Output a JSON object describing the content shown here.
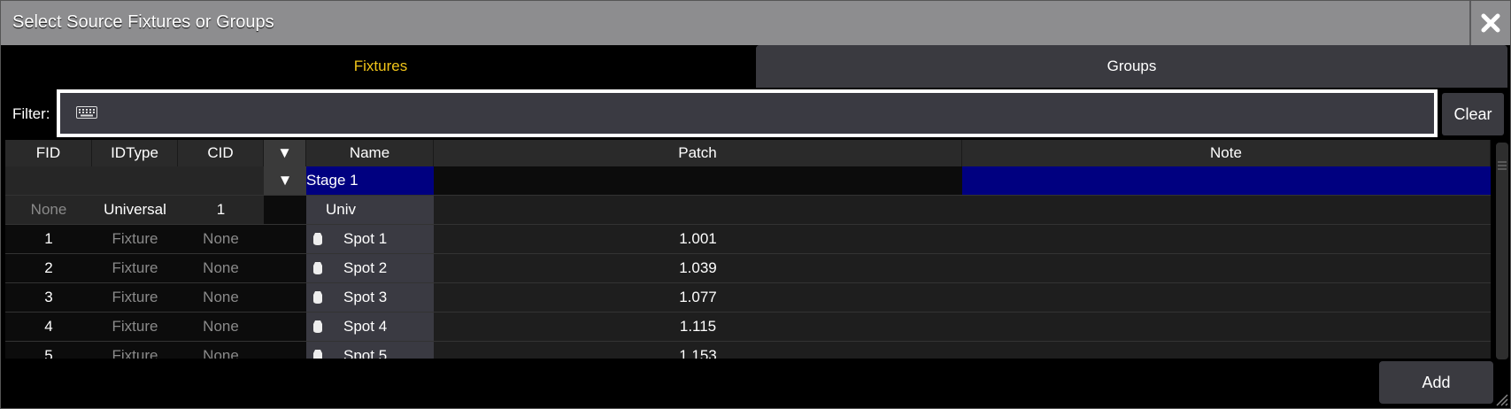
{
  "window": {
    "title": "Select Source Fixtures or Groups"
  },
  "tabs": [
    {
      "label": "Fixtures",
      "active": true
    },
    {
      "label": "Groups",
      "active": false
    }
  ],
  "filter": {
    "label": "Filter:",
    "value": "",
    "clear_label": "Clear"
  },
  "columns": [
    "FID",
    "IDType",
    "CID",
    "▼",
    "Name",
    "Patch",
    "Note"
  ],
  "stage": {
    "toggle": "▼",
    "name": "Stage 1"
  },
  "universal_row": {
    "fid": "None",
    "idtype": "Universal",
    "cid": "1",
    "name": "Univ"
  },
  "fixtures": [
    {
      "fid": "1",
      "idtype": "Fixture",
      "cid": "None",
      "name": "Spot 1",
      "patch": "1.001"
    },
    {
      "fid": "2",
      "idtype": "Fixture",
      "cid": "None",
      "name": "Spot 2",
      "patch": "1.039"
    },
    {
      "fid": "3",
      "idtype": "Fixture",
      "cid": "None",
      "name": "Spot 3",
      "patch": "1.077"
    },
    {
      "fid": "4",
      "idtype": "Fixture",
      "cid": "None",
      "name": "Spot 4",
      "patch": "1.115"
    },
    {
      "fid": "5",
      "idtype": "Fixture",
      "cid": "None",
      "name": "Spot 5",
      "patch": "1.153"
    }
  ],
  "footer": {
    "add_label": "Add"
  },
  "icons": {
    "close": "close-icon",
    "keyboard": "keyboard-icon",
    "fixture": "spot-fixture-icon"
  },
  "colors": {
    "accent_tab": "#f0c419",
    "stage_highlight": "#000080",
    "title_bar": "#8d8d8f"
  }
}
